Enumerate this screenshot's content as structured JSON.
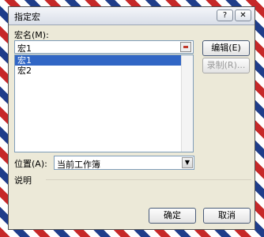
{
  "dialog": {
    "title": "指定宏",
    "help_glyph": "?",
    "close_glyph": "✕"
  },
  "macro_name": {
    "label": "宏名(M):",
    "value": "宏1"
  },
  "macro_list": {
    "items": [
      "宏1",
      "宏2"
    ],
    "selected_index": 0
  },
  "buttons": {
    "edit": "编辑(E)",
    "record": "录制(R)...",
    "ok": "确定",
    "cancel": "取消"
  },
  "location": {
    "label": "位置(A):",
    "value": "当前工作簿",
    "arrow_glyph": "▼"
  },
  "description": {
    "label": "说明"
  }
}
